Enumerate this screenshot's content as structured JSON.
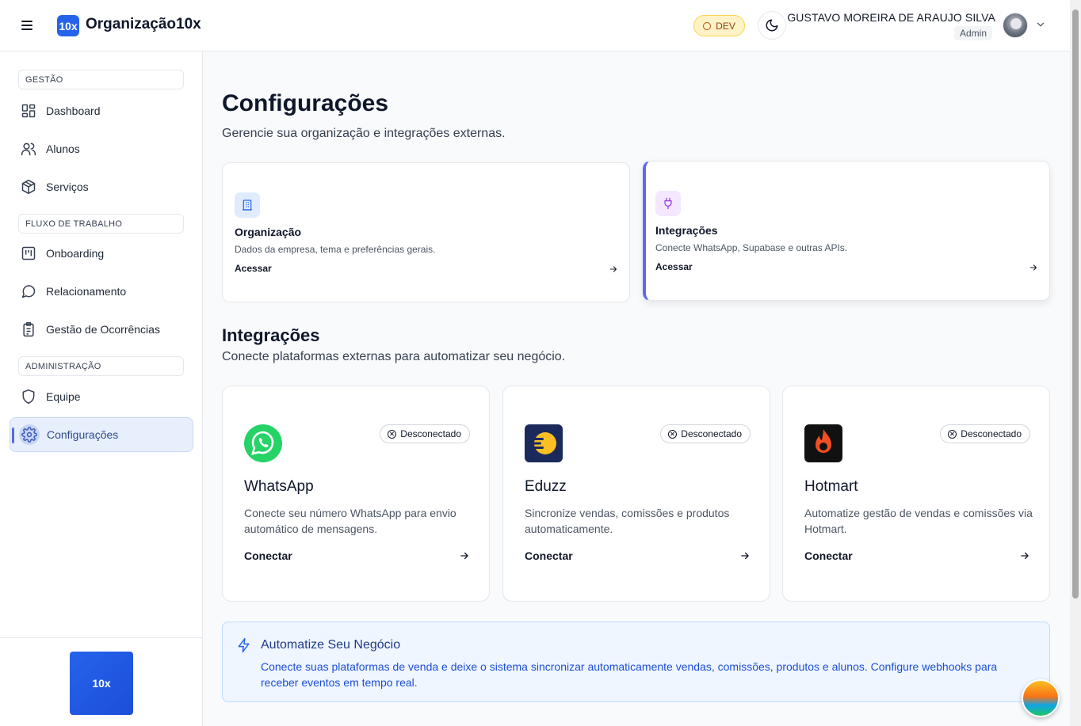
{
  "header": {
    "logo_badge": "10x",
    "org_name": "Organização10x",
    "env_badge": "DEV",
    "user_name": "GUSTAVO MOREIRA DE ARAUJO SILVA",
    "user_role": "Admin"
  },
  "sidebar": {
    "sections": [
      {
        "label": "GESTÃO"
      },
      {
        "label": "FLUXO DE TRABALHO"
      },
      {
        "label": "ADMINISTRAÇÃO"
      }
    ],
    "items": [
      {
        "label": "Dashboard",
        "icon": "dashboard-icon"
      },
      {
        "label": "Alunos",
        "icon": "users-icon"
      },
      {
        "label": "Serviços",
        "icon": "box-icon"
      },
      {
        "label": "Onboarding",
        "icon": "kanban-icon"
      },
      {
        "label": "Relacionamento",
        "icon": "chat-icon"
      },
      {
        "label": "Gestão de Ocorrências",
        "icon": "clipboard-icon"
      },
      {
        "label": "Equipe",
        "icon": "shield-icon"
      },
      {
        "label": "Configurações",
        "icon": "gear-icon",
        "active": true
      }
    ],
    "footer_logo": "10x"
  },
  "main": {
    "title": "Configurações",
    "subtitle": "Gerencie sua organização e integrações externas.",
    "settings_cards": [
      {
        "title": "Organização",
        "description": "Dados da empresa, tema e preferências gerais.",
        "link": "Acessar",
        "icon": "building-icon"
      },
      {
        "title": "Integrações",
        "description": "Conecte WhatsApp, Supabase e outras APIs.",
        "link": "Acessar",
        "icon": "plug-icon"
      }
    ],
    "integrations_title": "Integrações",
    "integrations_subtitle": "Conecte plataformas externas para automatizar seu negócio.",
    "integrations": [
      {
        "name": "WhatsApp",
        "status": "Desconectado",
        "description": "Conecte seu número WhatsApp para envio automático de mensagens.",
        "action": "Conectar",
        "brand_color": "#25d366"
      },
      {
        "name": "Eduzz",
        "status": "Desconectado",
        "description": "Sincronize vendas, comissões e produtos automaticamente.",
        "action": "Conectar",
        "brand_color": "#1b2a5a"
      },
      {
        "name": "Hotmart",
        "status": "Desconectado",
        "description": "Automatize gestão de vendas e comissões via Hotmart.",
        "action": "Conectar",
        "brand_color": "#f04e23"
      }
    ],
    "info_box": {
      "title": "Automatize Seu Negócio",
      "text": "Conecte suas plataformas de venda e deixe o sistema sincronizar automaticamente vendas, comissões, produtos e alunos. Configure webhooks para receber eventos em tempo real."
    }
  },
  "colors": {
    "accent": "#2563eb",
    "active_nav_bg": "#e8effc",
    "info_bg": "#eff6ff"
  }
}
